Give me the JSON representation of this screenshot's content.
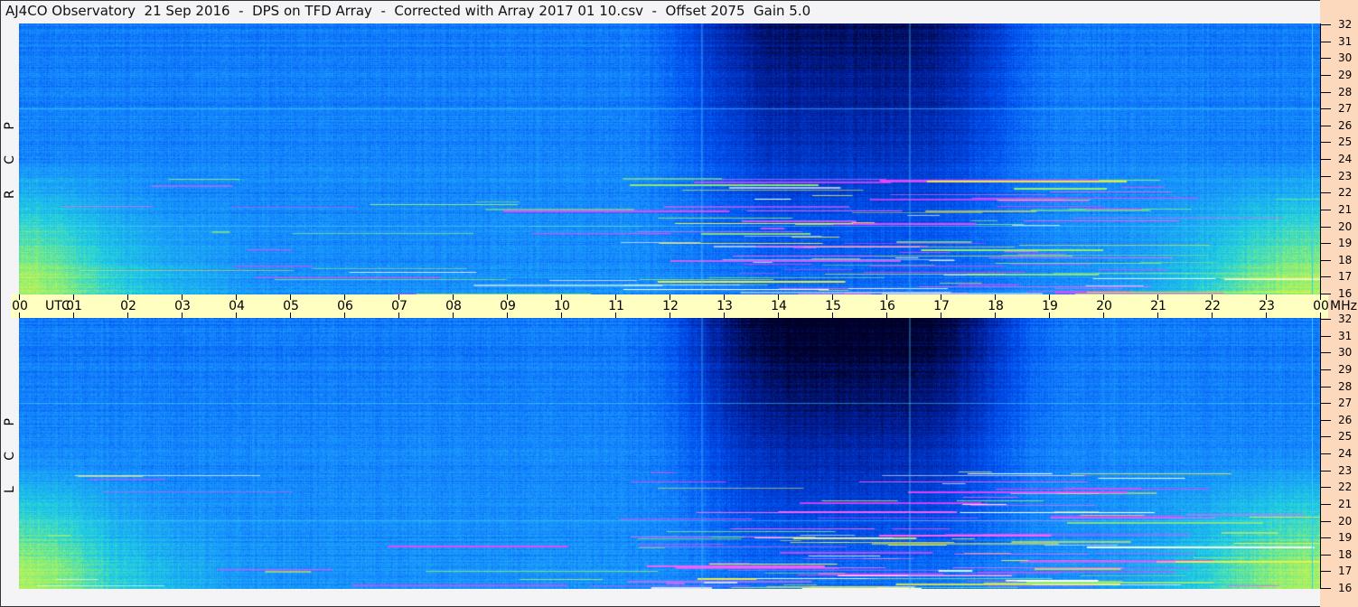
{
  "title": "AJ4CO Observatory  21 Sep 2016  -  DPS on TFD Array  -  Corrected with Array 2017 01 10.csv  -  Offset 2075  Gain 5.0",
  "chart_data": {
    "type": "heatmap",
    "title": "AJ4CO Observatory  21 Sep 2016  -  DPS on TFD Array  -  Corrected with Array 2017 01 10.csv  -  Offset 2075  Gain 5.0",
    "xlabel": "UTC",
    "ylabel": "MHz",
    "x_ticks": [
      "00",
      "01",
      "02",
      "03",
      "04",
      "05",
      "06",
      "07",
      "08",
      "09",
      "10",
      "11",
      "12",
      "13",
      "14",
      "15",
      "16",
      "17",
      "18",
      "19",
      "20",
      "21",
      "22",
      "23",
      "00"
    ],
    "y_ticks": [
      "32",
      "31",
      "30",
      "29",
      "28",
      "27",
      "26",
      "25",
      "24",
      "23",
      "22",
      "21",
      "20",
      "19",
      "18",
      "17",
      "16"
    ],
    "xlim": [
      0,
      24
    ],
    "ylim": [
      16,
      32
    ],
    "panels": [
      {
        "name": "RCP",
        "label": "R C P"
      },
      {
        "name": "LCP",
        "label": "L C P"
      }
    ],
    "colormap": [
      "#000028",
      "#0020a0",
      "#0050f0",
      "#1890ff",
      "#20d0e0",
      "#90f070",
      "#f0f040",
      "#ff40ff",
      "#ffffff"
    ]
  },
  "colors": {
    "axis_band": "#ffffc2",
    "right_panel": "#fcd8bd",
    "background": "#f4f4f6"
  }
}
